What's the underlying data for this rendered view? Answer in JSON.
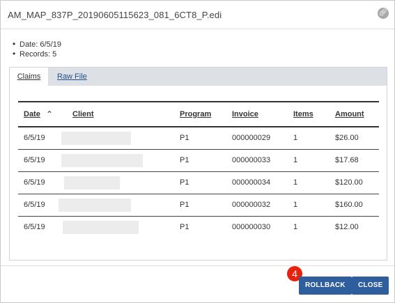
{
  "dialog": {
    "title": "AM_MAP_837P_20190605115623_081_6CT8_P.edi",
    "link_icon": "link-icon"
  },
  "meta": {
    "date": "Date: 6/5/19",
    "records": "Records: 5"
  },
  "tabs": [
    {
      "label": "Claims",
      "active": true
    },
    {
      "label": "Raw File",
      "active": false
    }
  ],
  "table": {
    "columns": [
      "Date",
      "Client",
      "Program",
      "Invoice",
      "Items",
      "Amount"
    ],
    "sort_icon": "sort-ascending-icon",
    "rows": [
      {
        "date": "6/5/19",
        "client": "",
        "program": "P1",
        "invoice": "000000029",
        "items": "1",
        "amount": "$26.00"
      },
      {
        "date": "6/5/19",
        "client": "",
        "program": "P1",
        "invoice": "000000033",
        "items": "1",
        "amount": "$17.68"
      },
      {
        "date": "6/5/19",
        "client": "",
        "program": "P1",
        "invoice": "000000034",
        "items": "1",
        "amount": "$120.00"
      },
      {
        "date": "6/5/19",
        "client": "",
        "program": "P1",
        "invoice": "000000032",
        "items": "1",
        "amount": "$160.00"
      },
      {
        "date": "6/5/19",
        "client": "",
        "program": "P1",
        "invoice": "000000030",
        "items": "1",
        "amount": "$12.00"
      }
    ]
  },
  "footer": {
    "rollback_label": "ROLLBACK",
    "close_label": "CLOSE",
    "step_badge": "4"
  },
  "colors": {
    "button": "#2f5e9e",
    "badge": "#e8210d",
    "tab_bar": "#dde1e6"
  }
}
